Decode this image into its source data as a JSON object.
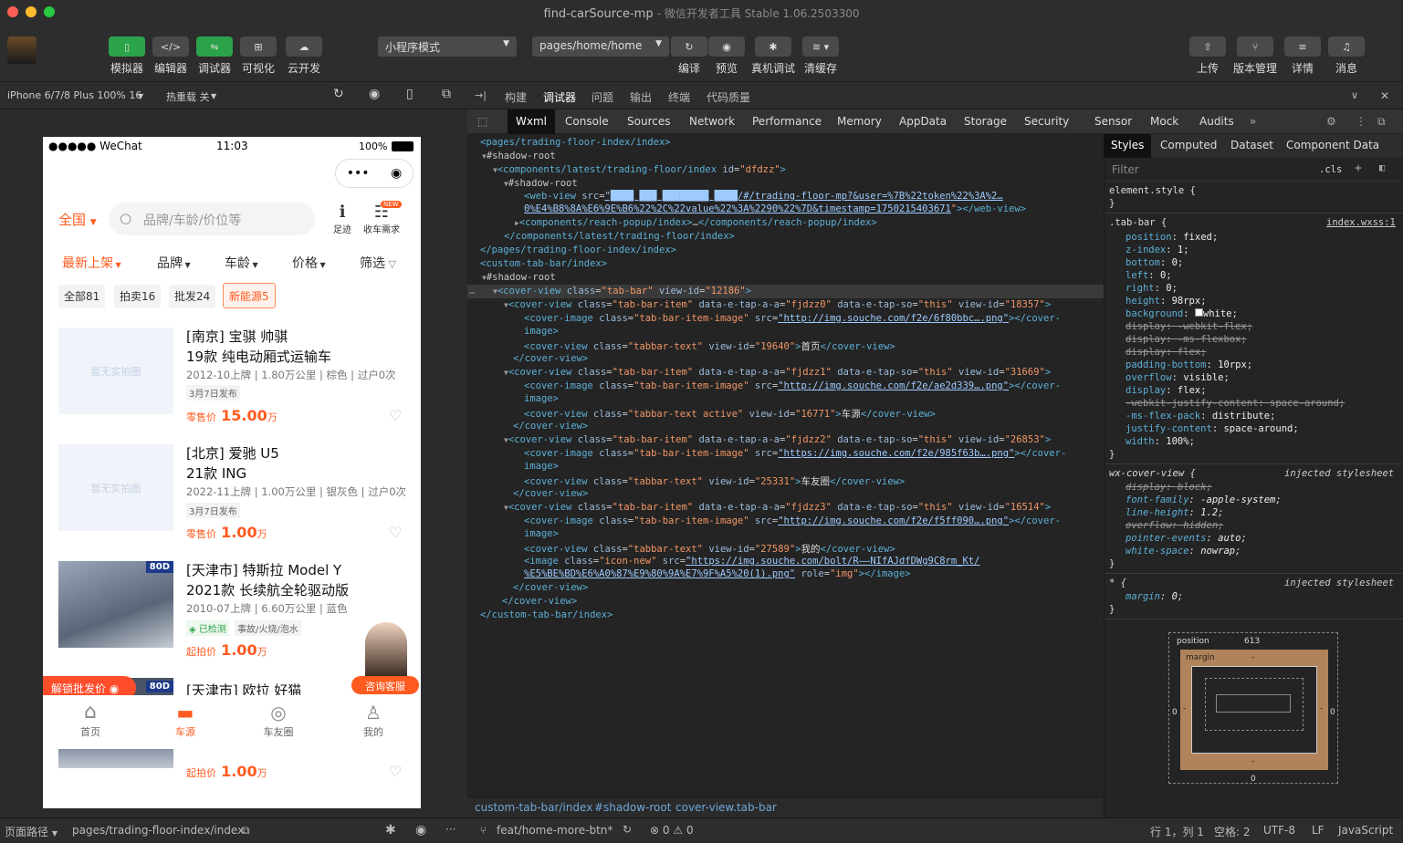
{
  "window": {
    "title": "find-carSource-mp",
    "subtitle": "- 微信开发者工具 Stable 1.06.2503300"
  },
  "toolbar": {
    "simulator": "模拟器",
    "editor": "编辑器",
    "debugger": "调试器",
    "visual": "可视化",
    "cloud": "云开发",
    "mode": "小程序模式",
    "page_path": "pages/home/home",
    "compile": "编译",
    "preview": "预览",
    "real_debug": "真机调试",
    "clear_cache": "清缓存",
    "upload": "上传",
    "version": "版本管理",
    "details": "详情",
    "messages": "消息"
  },
  "simbar": {
    "device": "iPhone 6/7/8 Plus 100% 16",
    "hot_reload": "热重载 关"
  },
  "phone": {
    "status": {
      "carrier": "●●●●● WeChat",
      "time": "11:03",
      "battery": "100%"
    },
    "region": "全国",
    "search_placeholder": "品牌/车龄/价位等",
    "footprint": "足迹",
    "demand": "收车需求",
    "new_badge": "NEW",
    "filters": [
      "最新上架",
      "品牌",
      "车龄",
      "价格",
      "筛选"
    ],
    "chips": [
      "全部81",
      "拍卖16",
      "批发24",
      "新能源5"
    ],
    "no_photo": "暂无实拍图",
    "cars": [
      {
        "title1": "[南京] 宝骐 帅骐",
        "title2": "19款 纯电动厢式运输车",
        "info": "2012-10上牌 | 1.80万公里 | 棕色 | 过户0次",
        "date": "3月7日发布",
        "price_label": "零售价",
        "price": "15.00",
        "unit": "万"
      },
      {
        "title1": "[北京] 爱驰 U5",
        "title2": "21款 ING",
        "info": "2022-11上牌 | 1.00万公里 | 银灰色 | 过户0次",
        "date": "3月7日发布",
        "price_label": "零售价",
        "price": "1.00",
        "unit": "万"
      },
      {
        "title1": "[天津市] 特斯拉 Model Y",
        "title2": "2021款 长续航全轮驱动版",
        "info": "2010-07上牌 | 6.60万公里 | 蓝色",
        "tag1": "已检测",
        "tag2": "事故/火烧/泡水",
        "price_label": "起拍价",
        "price": "1.00",
        "unit": "万",
        "badge": "80D"
      },
      {
        "title1": "[天津市] 欧拉 好猫",
        "price_label": "起拍价",
        "price": "1.00",
        "unit": "万",
        "badge": "80D"
      }
    ],
    "unlock": "解锁批发价",
    "consult": "咨询客服",
    "tabs": [
      "首页",
      "车源",
      "车友圈",
      "我的"
    ]
  },
  "bottom_left": {
    "page_path_label": "页面路径",
    "page_path": "pages/trading-floor-index/index"
  },
  "devtools": {
    "top_tabs": [
      "构建",
      "调试器",
      "问题",
      "输出",
      "终端",
      "代码质量"
    ],
    "sub_tabs": [
      "Wxml",
      "Console",
      "Sources",
      "Network",
      "Performance",
      "Memory",
      "AppData",
      "Storage",
      "Security",
      "Sensor",
      "Mock",
      "Audits"
    ],
    "style_tabs": [
      "Styles",
      "Computed",
      "Dataset",
      "Component Data"
    ],
    "filter_placeholder": "Filter",
    "cls": ".cls",
    "breadcrumbs": [
      "custom-tab-bar/index",
      "#shadow-root",
      "cover-view.tab-bar"
    ],
    "status": {
      "branch": "feat/home-more-btn*",
      "errors": "0",
      "warnings": "0",
      "pos": "行 1，列 1",
      "spaces": "空格: 2",
      "encoding": "UTF-8",
      "eol": "LF",
      "lang": "JavaScript"
    },
    "box": {
      "position_label": "position",
      "position_value": "613",
      "margin_label": "margin",
      "zero": "0",
      "dash": "-"
    }
  }
}
